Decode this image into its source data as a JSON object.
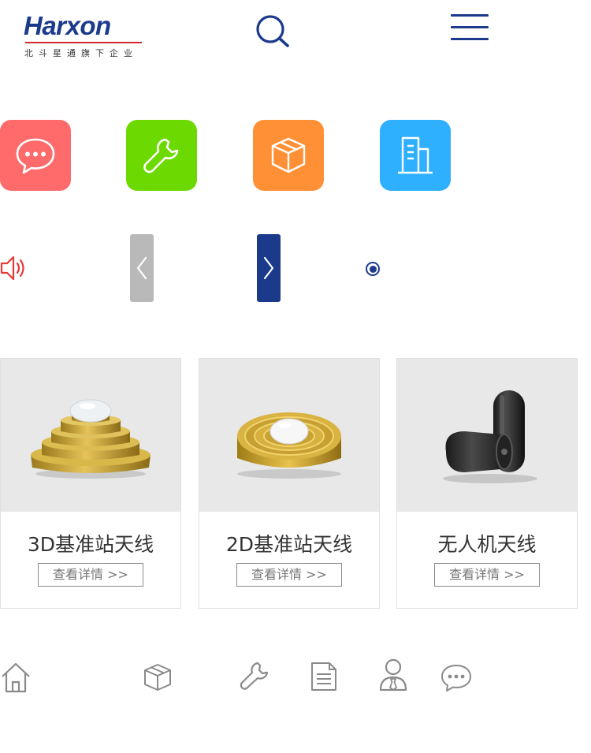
{
  "header": {
    "logo_text": "Harxon",
    "logo_subtitle": "北斗星通旗下企业",
    "search_icon": "search-icon",
    "menu_icon": "menu-icon"
  },
  "quick_links": [
    {
      "icon": "chat-icon",
      "color": "#ff6b6b"
    },
    {
      "icon": "wrench-icon",
      "color": "#6cd900"
    },
    {
      "icon": "box-icon",
      "color": "#ff9035"
    },
    {
      "icon": "building-icon",
      "color": "#2fb0ff"
    }
  ],
  "notice": {
    "speaker_icon": "speaker-icon",
    "prev_icon": "chevron-left-icon",
    "next_icon": "chevron-right-icon",
    "accent": "#1b3a8c"
  },
  "products": [
    {
      "title": "3D基准站天线",
      "button": "查看详情 >>"
    },
    {
      "title": "2D基准站天线",
      "button": "查看详情 >>"
    },
    {
      "title": "无人机天线",
      "button": "查看详情 >>"
    }
  ],
  "bottom_nav": [
    "home-icon",
    "box-icon",
    "wrench-icon",
    "document-icon",
    "user-tie-icon",
    "chat-icon"
  ]
}
